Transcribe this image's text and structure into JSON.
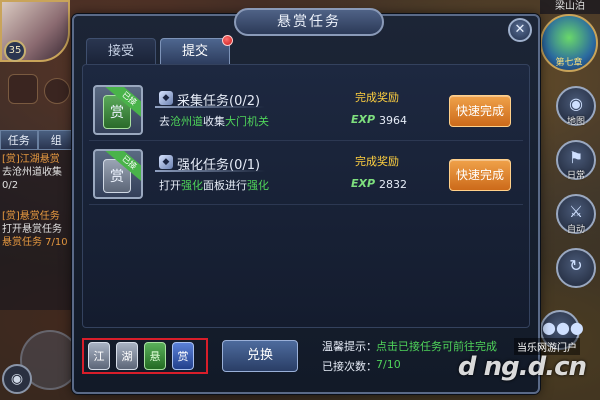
{
  "dialog": {
    "title": "悬赏任务",
    "tabs": [
      {
        "label": "接受",
        "active": false
      },
      {
        "label": "提交",
        "active": true,
        "has_notification": true
      }
    ]
  },
  "quests": [
    {
      "card_symbol": "赏",
      "card_color": "green",
      "ribbon": "已接",
      "title": "采集任务(0/2)",
      "desc_parts": [
        "去",
        "沧州道",
        "收集",
        "大门机关"
      ],
      "reward_label": "完成奖励",
      "exp_label": "EXP",
      "exp_value": "3964",
      "button_label": "快速完成"
    },
    {
      "card_symbol": "赏",
      "card_color": "gray",
      "ribbon": "已接",
      "title": "强化任务(0/1)",
      "desc_parts": [
        "打开",
        "强化",
        "面板进行",
        "强化"
      ],
      "reward_label": "完成奖励",
      "exp_label": "EXP",
      "exp_value": "2832",
      "button_label": "快速完成"
    }
  ],
  "footer": {
    "tokens": [
      {
        "label": "江",
        "color": "gray"
      },
      {
        "label": "湖",
        "color": "gray"
      },
      {
        "label": "悬",
        "color": "green"
      },
      {
        "label": "赏",
        "color": "blue"
      }
    ],
    "exchange_label": "兑换",
    "tip_label": "温馨提示：",
    "tip_text": "点击已接任务可前往完成",
    "count_label": "已接次数：",
    "count_value": "7/10"
  },
  "hud": {
    "player_level": "35",
    "left_tabs": [
      "任务",
      "组"
    ],
    "quest_log": [
      {
        "text": "[赏]江湖悬赏",
        "color": "orange"
      },
      {
        "text": "去沧州道收集",
        "color": "white"
      },
      {
        "text": "0/2",
        "color": "white"
      },
      {
        "text": "[赏]悬赏任务",
        "color": "orange"
      },
      {
        "text": "打开悬赏任务",
        "color": "white"
      },
      {
        "text": "悬赏任务 7/10",
        "color": "orange"
      }
    ],
    "map_name": "梁山泊",
    "chapter_label": "第七章",
    "right_buttons": [
      {
        "label": "地图",
        "glyph": "◉"
      },
      {
        "label": "日常",
        "glyph": "⚑"
      },
      {
        "label": "自动",
        "glyph": "⚔"
      },
      {
        "label": "",
        "glyph": "↻"
      }
    ]
  },
  "watermark": {
    "site": "当乐网游门户",
    "logo": "d ng.d.cn"
  }
}
